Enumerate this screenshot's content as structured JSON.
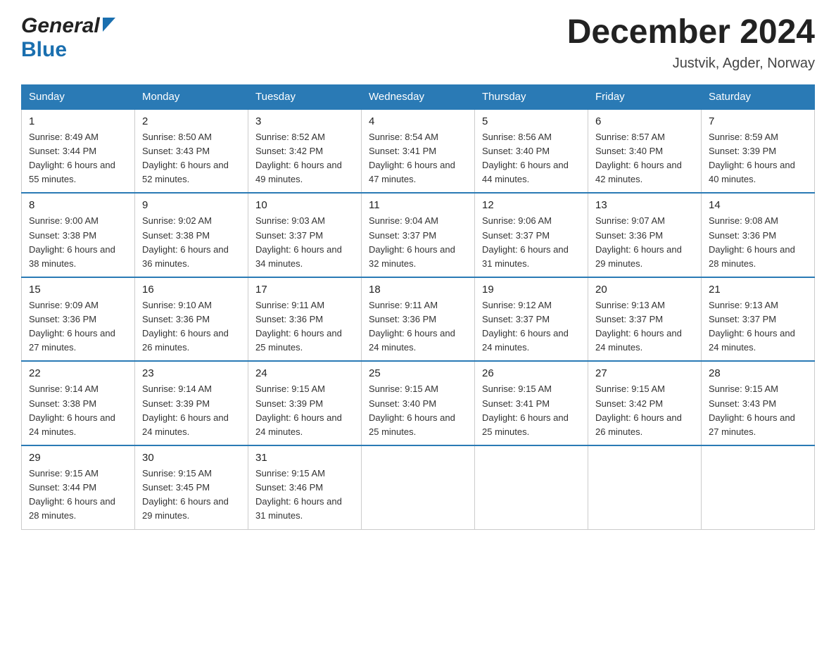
{
  "header": {
    "logo_general": "General",
    "logo_blue": "Blue",
    "title": "December 2024",
    "subtitle": "Justvik, Agder, Norway"
  },
  "calendar": {
    "days_of_week": [
      "Sunday",
      "Monday",
      "Tuesday",
      "Wednesday",
      "Thursday",
      "Friday",
      "Saturday"
    ],
    "weeks": [
      [
        {
          "day": "1",
          "sunrise": "8:49 AM",
          "sunset": "3:44 PM",
          "daylight": "6 hours and 55 minutes."
        },
        {
          "day": "2",
          "sunrise": "8:50 AM",
          "sunset": "3:43 PM",
          "daylight": "6 hours and 52 minutes."
        },
        {
          "day": "3",
          "sunrise": "8:52 AM",
          "sunset": "3:42 PM",
          "daylight": "6 hours and 49 minutes."
        },
        {
          "day": "4",
          "sunrise": "8:54 AM",
          "sunset": "3:41 PM",
          "daylight": "6 hours and 47 minutes."
        },
        {
          "day": "5",
          "sunrise": "8:56 AM",
          "sunset": "3:40 PM",
          "daylight": "6 hours and 44 minutes."
        },
        {
          "day": "6",
          "sunrise": "8:57 AM",
          "sunset": "3:40 PM",
          "daylight": "6 hours and 42 minutes."
        },
        {
          "day": "7",
          "sunrise": "8:59 AM",
          "sunset": "3:39 PM",
          "daylight": "6 hours and 40 minutes."
        }
      ],
      [
        {
          "day": "8",
          "sunrise": "9:00 AM",
          "sunset": "3:38 PM",
          "daylight": "6 hours and 38 minutes."
        },
        {
          "day": "9",
          "sunrise": "9:02 AM",
          "sunset": "3:38 PM",
          "daylight": "6 hours and 36 minutes."
        },
        {
          "day": "10",
          "sunrise": "9:03 AM",
          "sunset": "3:37 PM",
          "daylight": "6 hours and 34 minutes."
        },
        {
          "day": "11",
          "sunrise": "9:04 AM",
          "sunset": "3:37 PM",
          "daylight": "6 hours and 32 minutes."
        },
        {
          "day": "12",
          "sunrise": "9:06 AM",
          "sunset": "3:37 PM",
          "daylight": "6 hours and 31 minutes."
        },
        {
          "day": "13",
          "sunrise": "9:07 AM",
          "sunset": "3:36 PM",
          "daylight": "6 hours and 29 minutes."
        },
        {
          "day": "14",
          "sunrise": "9:08 AM",
          "sunset": "3:36 PM",
          "daylight": "6 hours and 28 minutes."
        }
      ],
      [
        {
          "day": "15",
          "sunrise": "9:09 AM",
          "sunset": "3:36 PM",
          "daylight": "6 hours and 27 minutes."
        },
        {
          "day": "16",
          "sunrise": "9:10 AM",
          "sunset": "3:36 PM",
          "daylight": "6 hours and 26 minutes."
        },
        {
          "day": "17",
          "sunrise": "9:11 AM",
          "sunset": "3:36 PM",
          "daylight": "6 hours and 25 minutes."
        },
        {
          "day": "18",
          "sunrise": "9:11 AM",
          "sunset": "3:36 PM",
          "daylight": "6 hours and 24 minutes."
        },
        {
          "day": "19",
          "sunrise": "9:12 AM",
          "sunset": "3:37 PM",
          "daylight": "6 hours and 24 minutes."
        },
        {
          "day": "20",
          "sunrise": "9:13 AM",
          "sunset": "3:37 PM",
          "daylight": "6 hours and 24 minutes."
        },
        {
          "day": "21",
          "sunrise": "9:13 AM",
          "sunset": "3:37 PM",
          "daylight": "6 hours and 24 minutes."
        }
      ],
      [
        {
          "day": "22",
          "sunrise": "9:14 AM",
          "sunset": "3:38 PM",
          "daylight": "6 hours and 24 minutes."
        },
        {
          "day": "23",
          "sunrise": "9:14 AM",
          "sunset": "3:39 PM",
          "daylight": "6 hours and 24 minutes."
        },
        {
          "day": "24",
          "sunrise": "9:15 AM",
          "sunset": "3:39 PM",
          "daylight": "6 hours and 24 minutes."
        },
        {
          "day": "25",
          "sunrise": "9:15 AM",
          "sunset": "3:40 PM",
          "daylight": "6 hours and 25 minutes."
        },
        {
          "day": "26",
          "sunrise": "9:15 AM",
          "sunset": "3:41 PM",
          "daylight": "6 hours and 25 minutes."
        },
        {
          "day": "27",
          "sunrise": "9:15 AM",
          "sunset": "3:42 PM",
          "daylight": "6 hours and 26 minutes."
        },
        {
          "day": "28",
          "sunrise": "9:15 AM",
          "sunset": "3:43 PM",
          "daylight": "6 hours and 27 minutes."
        }
      ],
      [
        {
          "day": "29",
          "sunrise": "9:15 AM",
          "sunset": "3:44 PM",
          "daylight": "6 hours and 28 minutes."
        },
        {
          "day": "30",
          "sunrise": "9:15 AM",
          "sunset": "3:45 PM",
          "daylight": "6 hours and 29 minutes."
        },
        {
          "day": "31",
          "sunrise": "9:15 AM",
          "sunset": "3:46 PM",
          "daylight": "6 hours and 31 minutes."
        },
        null,
        null,
        null,
        null
      ]
    ]
  }
}
